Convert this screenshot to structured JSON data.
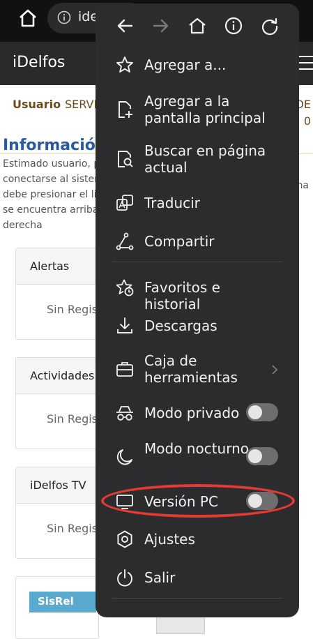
{
  "browser": {
    "url_partial": "ide"
  },
  "site": {
    "brand": "iDelfos",
    "nav": {
      "usuario": "Usuario",
      "servicios": "SERVI",
      "right_partial": "DE",
      "right_number": "0"
    },
    "info_title": "Información",
    "info_lines": [
      "Estimado usuario, p",
      "conectarse al sistem",
      "debe presionar el lir",
      "se encuentra arriba",
      "derecha"
    ],
    "info_right_fragment": "na",
    "cards": [
      {
        "title": "Alertas",
        "body": "Sin Regis"
      },
      {
        "title": "Actividades",
        "body": "Sin Regis"
      },
      {
        "title": "iDelfos TV",
        "body": "Sin Regis"
      }
    ],
    "ad_logo": "SisRel"
  },
  "menu": {
    "toolbar_icons": [
      "back-icon",
      "forward-icon",
      "home-icon",
      "info-icon",
      "reload-icon"
    ],
    "items": [
      {
        "label": "Agregar a...",
        "icon": "star-icon"
      },
      {
        "label": "Agregar a la pantalla principal",
        "icon": "add-to-home-icon"
      },
      {
        "label": "Buscar en página actual",
        "icon": "find-in-page-icon"
      },
      {
        "label": "Traducir",
        "icon": "translate-icon"
      },
      {
        "label": "Compartir",
        "icon": "share-icon"
      },
      {
        "label": "Favoritos e historial",
        "icon": "favorites-icon"
      },
      {
        "label": "Descargas",
        "icon": "download-icon"
      },
      {
        "label": "Caja de herramientas",
        "icon": "toolbox-icon"
      },
      {
        "label": "Modo privado",
        "icon": "incognito-icon",
        "toggle": false
      },
      {
        "label": "Modo nocturno",
        "icon": "moon-icon",
        "toggle": false
      },
      {
        "label": "Versión PC",
        "icon": "desktop-icon",
        "toggle": false
      },
      {
        "label": "Ajustes",
        "icon": "gear-icon"
      },
      {
        "label": "Salir",
        "icon": "power-icon"
      }
    ]
  },
  "colors": {
    "menu_bg": "#2c2c2e",
    "highlight": "#e23b33",
    "brand_nav": "#6b4a1e",
    "info_title": "#2a5aa0"
  }
}
